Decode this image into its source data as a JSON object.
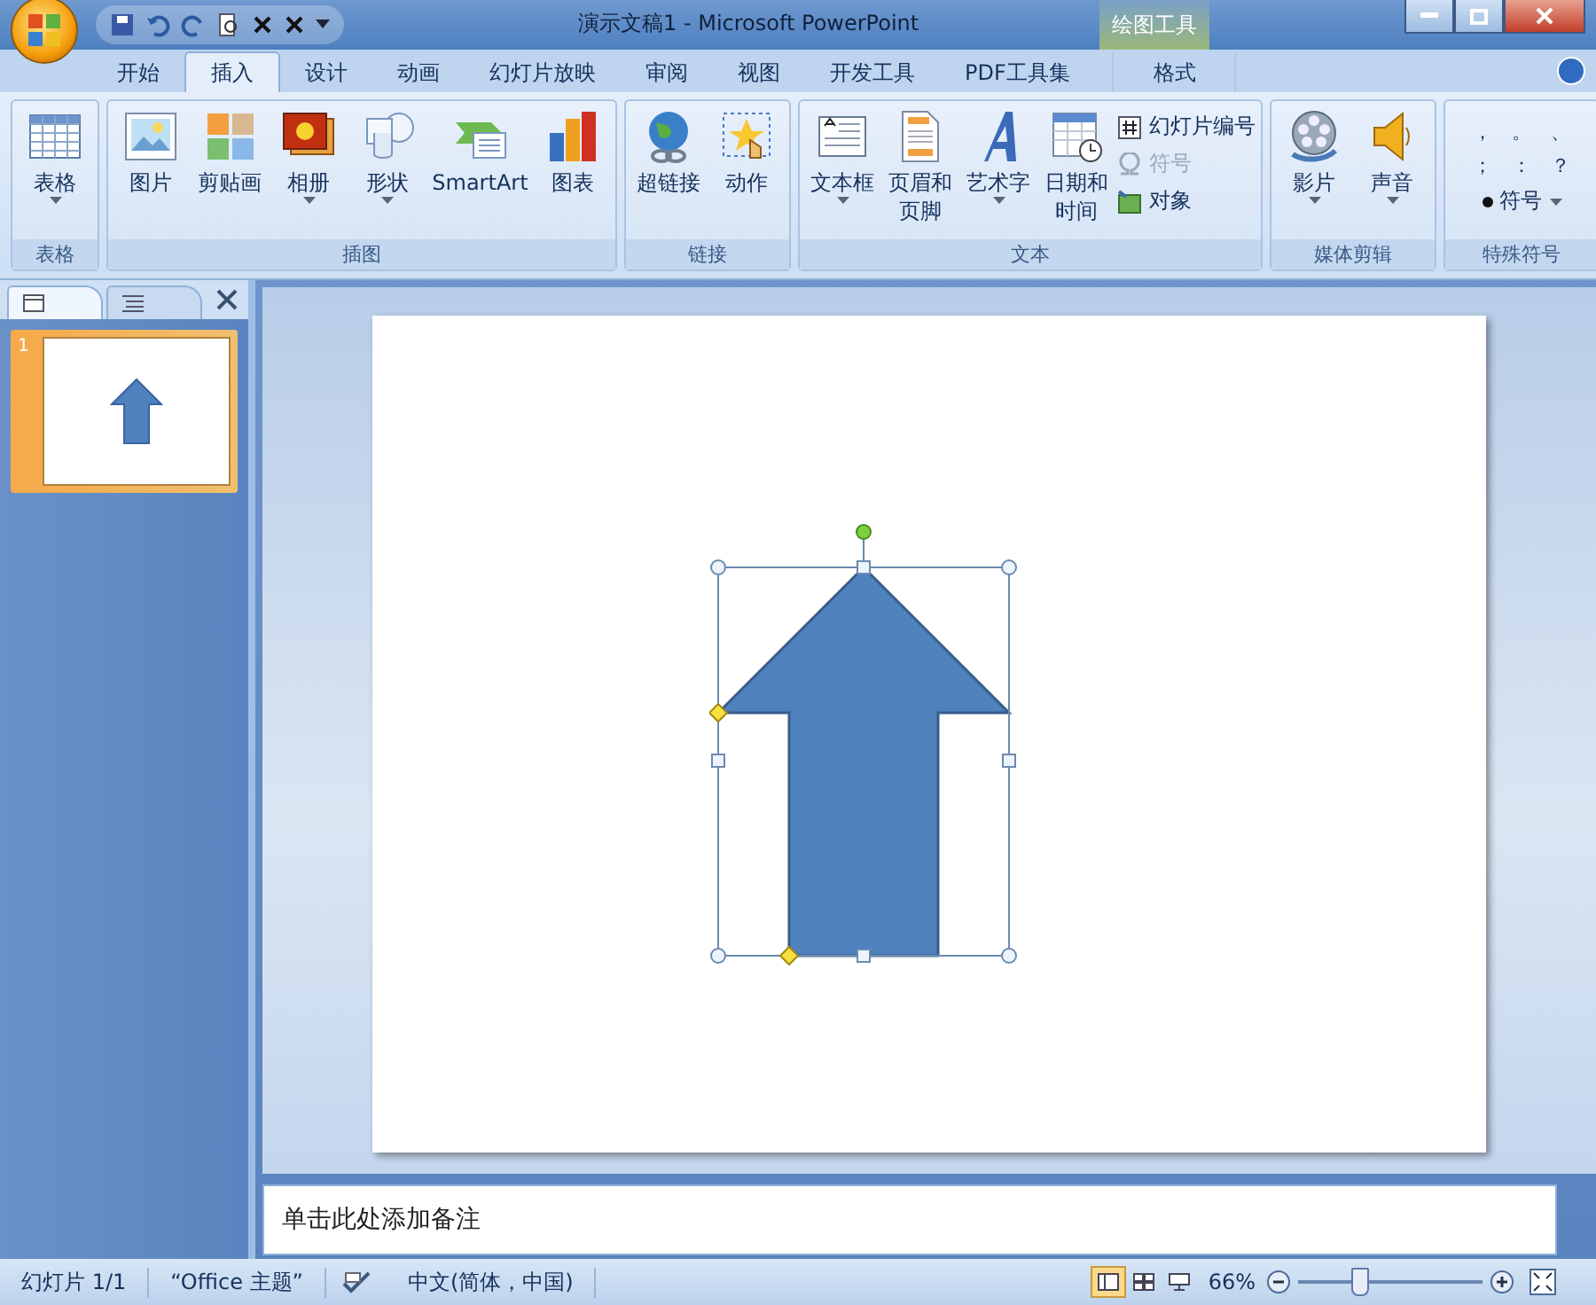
{
  "window": {
    "title": "演示文稿1 - Microsoft PowerPoint",
    "context_label": "绘图工具"
  },
  "tabs": [
    {
      "label": "开始",
      "selected": false,
      "kind": "normal"
    },
    {
      "label": "插入",
      "selected": true,
      "kind": "normal"
    },
    {
      "label": "设计",
      "selected": false,
      "kind": "normal"
    },
    {
      "label": "动画",
      "selected": false,
      "kind": "normal"
    },
    {
      "label": "幻灯片放映",
      "selected": false,
      "kind": "normal"
    },
    {
      "label": "审阅",
      "selected": false,
      "kind": "normal"
    },
    {
      "label": "视图",
      "selected": false,
      "kind": "normal"
    },
    {
      "label": "开发工具",
      "selected": false,
      "kind": "normal"
    },
    {
      "label": "PDF工具集",
      "selected": false,
      "kind": "normal"
    },
    {
      "label": "格式",
      "selected": false,
      "kind": "contextual"
    }
  ],
  "ribbon_groups": [
    {
      "label": "表格",
      "items": [
        {
          "kind": "large",
          "label": "表格",
          "dropdown": true
        }
      ]
    },
    {
      "label": "插图",
      "items": [
        {
          "kind": "large",
          "label": "图片",
          "dropdown": false
        },
        {
          "kind": "large",
          "label": "剪贴画",
          "dropdown": false
        },
        {
          "kind": "large",
          "label": "相册",
          "dropdown": true
        },
        {
          "kind": "large",
          "label": "形状",
          "dropdown": true
        },
        {
          "kind": "large",
          "label": "SmartArt",
          "dropdown": false
        },
        {
          "kind": "large",
          "label": "图表",
          "dropdown": false
        }
      ]
    },
    {
      "label": "链接",
      "items": [
        {
          "kind": "large",
          "label": "超链接",
          "dropdown": false
        },
        {
          "kind": "large",
          "label": "动作",
          "dropdown": false
        }
      ]
    },
    {
      "label": "文本",
      "items": [
        {
          "kind": "large",
          "label": "文本框",
          "dropdown": true
        },
        {
          "kind": "large",
          "label": "页眉和页脚",
          "dropdown": false
        },
        {
          "kind": "large",
          "label": "艺术字",
          "dropdown": true
        },
        {
          "kind": "large",
          "label": "日期和时间",
          "dropdown": false
        },
        {
          "kind": "small",
          "label": "幻灯片编号",
          "disabled": false
        },
        {
          "kind": "small",
          "label": "符号",
          "disabled": true
        },
        {
          "kind": "small",
          "label": "对象",
          "disabled": false
        }
      ]
    },
    {
      "label": "媒体剪辑",
      "items": [
        {
          "kind": "large",
          "label": "影片",
          "dropdown": true
        },
        {
          "kind": "large",
          "label": "声音",
          "dropdown": true
        }
      ]
    },
    {
      "label": "特殊符号",
      "items": [
        {
          "kind": "symbols",
          "symbols": [
            "，",
            "。",
            "、",
            "；",
            "：",
            "？"
          ],
          "label": "符号",
          "dropdown": true
        }
      ]
    }
  ],
  "slide_panel": {
    "tabs": [
      {
        "kind": "slides",
        "selected": true
      },
      {
        "kind": "outline",
        "selected": false
      }
    ],
    "slides": [
      {
        "number": "1",
        "selected": true
      }
    ]
  },
  "slide": {
    "shape": {
      "kind": "up-arrow",
      "selected": true
    }
  },
  "notes_prompt": "单击此处添加备注",
  "status_bar": {
    "slide": "幻灯片 1/1",
    "theme": "“Office 主题”",
    "language": "中文(简体，中国)",
    "zoom": "66%",
    "zoom_level": {
      "level": 0.33
    },
    "views": [
      {
        "kind": "normal",
        "selected": true
      },
      {
        "kind": "sorter",
        "selected": false
      },
      {
        "kind": "show",
        "selected": false
      }
    ]
  }
}
